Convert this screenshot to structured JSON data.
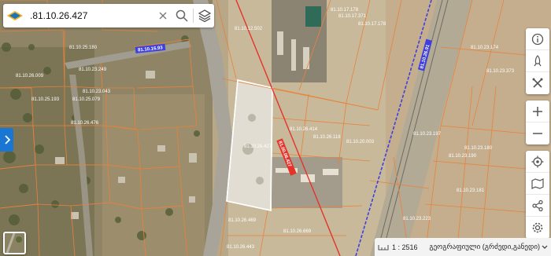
{
  "search": {
    "query": ".81.10.26.427"
  },
  "map": {
    "road_labels": [
      "81.10.16.93",
      "81.10.26.91",
      "81.00.06.427"
    ],
    "parcel_labels": [
      "81.10.12.502",
      "81.10.17.178",
      "81.10.17.178",
      "81.10.17.371",
      "81.10.23.174",
      "81.10.23.373",
      "81.10.25.180",
      "81.10.23.249",
      "81.10.26.009",
      "81.10.25.193",
      "81.10.25.079",
      "81.10.23.043",
      "81.10.26.476",
      "81.10.26.414",
      "81.10.26.427",
      "81.10.26.118",
      "81.10.20.003",
      "81.10.23.197",
      "81.10.23.180",
      "81.10.23.190",
      "81.10.23.181",
      "81.10.26.469",
      "81.10.26.669",
      "81.10.26.443",
      "81.10.23.223"
    ]
  },
  "toolbar": {
    "items": [
      "info-icon",
      "rocket-icon",
      "crossed-tools-icon",
      "zoom-in-icon",
      "zoom-out-icon",
      "locate-icon",
      "map-layers-icon",
      "share-icon",
      "settings-icon"
    ]
  },
  "status": {
    "scale": "1 : 2516",
    "basemap": "გეოგრაფიული (გრძედი,განედი)"
  },
  "colors": {
    "parcel": "#e8823a",
    "selected": "#ffffff",
    "cadastral_line": "#e6332a",
    "boundary": "#3f3fe0",
    "accent": "#1976d2"
  }
}
